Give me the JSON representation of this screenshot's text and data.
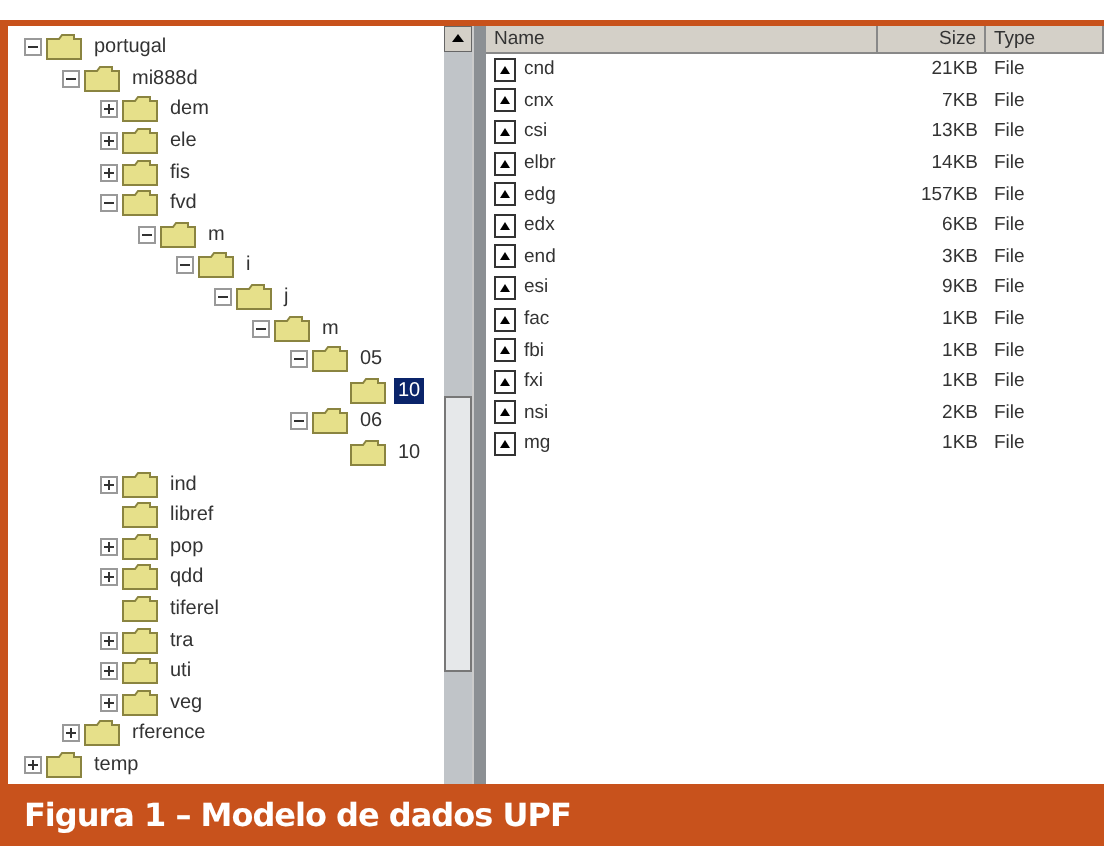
{
  "tree": [
    {
      "label": "portugal",
      "expanded": true,
      "selected": false,
      "children": [
        {
          "label": "mi888d",
          "expanded": true,
          "selected": false,
          "children": [
            {
              "label": "dem",
              "expanded": false,
              "selected": false
            },
            {
              "label": "ele",
              "expanded": false,
              "selected": false
            },
            {
              "label": "fis",
              "expanded": false,
              "selected": false
            },
            {
              "label": "fvd",
              "expanded": true,
              "selected": false,
              "children": [
                {
                  "label": "m",
                  "expanded": true,
                  "selected": false,
                  "children": [
                    {
                      "label": "i",
                      "expanded": true,
                      "selected": false,
                      "children": [
                        {
                          "label": "j",
                          "expanded": true,
                          "selected": false,
                          "children": [
                            {
                              "label": "m",
                              "expanded": true,
                              "selected": false,
                              "children": [
                                {
                                  "label": "05",
                                  "expanded": true,
                                  "selected": false,
                                  "children": [
                                    {
                                      "label": "10",
                                      "selected": true
                                    }
                                  ]
                                },
                                {
                                  "label": "06",
                                  "expanded": true,
                                  "selected": false,
                                  "children": [
                                    {
                                      "label": "10",
                                      "selected": false
                                    }
                                  ]
                                }
                              ]
                            }
                          ]
                        }
                      ]
                    }
                  ]
                }
              ]
            },
            {
              "label": "ind",
              "expanded": false,
              "selected": false
            },
            {
              "label": "libref",
              "selected": false
            },
            {
              "label": "pop",
              "expanded": false,
              "selected": false
            },
            {
              "label": "qdd",
              "expanded": false,
              "selected": false
            },
            {
              "label": "tiferel",
              "selected": false
            },
            {
              "label": "tra",
              "expanded": false,
              "selected": false
            },
            {
              "label": "uti",
              "expanded": false,
              "selected": false
            },
            {
              "label": "veg",
              "expanded": false,
              "selected": false
            }
          ]
        },
        {
          "label": "rference",
          "expanded": false,
          "selected": false
        }
      ]
    },
    {
      "label": "temp",
      "expanded": false,
      "selected": false
    }
  ],
  "list": {
    "columns": [
      "Name",
      "Size",
      "Type"
    ],
    "rows": [
      {
        "name": "cnd",
        "size": "21KB",
        "type": "File"
      },
      {
        "name": "cnx",
        "size": "7KB",
        "type": "File"
      },
      {
        "name": "csi",
        "size": "13KB",
        "type": "File"
      },
      {
        "name": "elbr",
        "size": "14KB",
        "type": "File"
      },
      {
        "name": "edg",
        "size": "157KB",
        "type": "File"
      },
      {
        "name": "edx",
        "size": "6KB",
        "type": "File"
      },
      {
        "name": "end",
        "size": "3KB",
        "type": "File"
      },
      {
        "name": "esi",
        "size": "9KB",
        "type": "File"
      },
      {
        "name": "fac",
        "size": "1KB",
        "type": "File"
      },
      {
        "name": "fbi",
        "size": "1KB",
        "type": "File"
      },
      {
        "name": "fxi",
        "size": "1KB",
        "type": "File"
      },
      {
        "name": "nsi",
        "size": "2KB",
        "type": "File"
      },
      {
        "name": "mg",
        "size": "1KB",
        "type": "File"
      }
    ]
  },
  "caption": "Figura 1 – Modelo de dados UPF"
}
